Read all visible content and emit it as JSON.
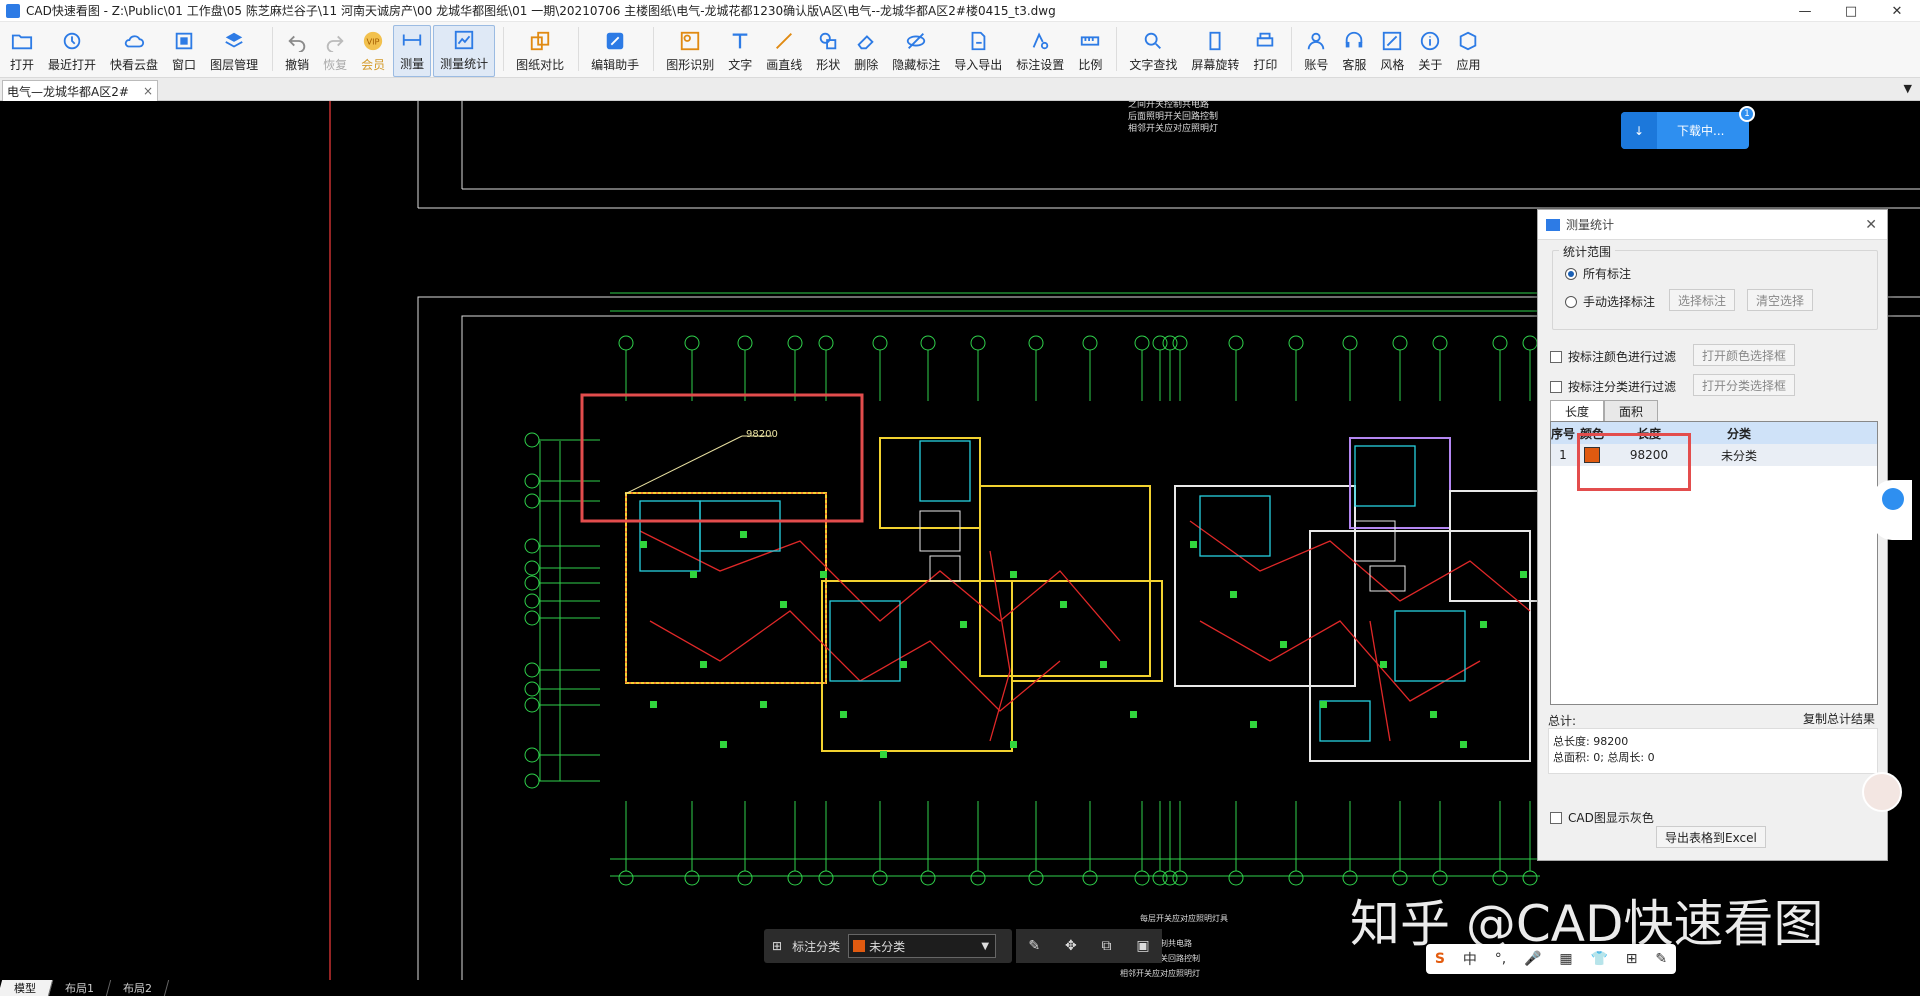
{
  "window": {
    "title": "CAD快速看图 - Z:\\Public\\01 工作盘\\05 陈芝麻烂谷子\\11 河南天诚房产\\00 龙城华都图纸\\01 一期\\20210706 主楼图纸\\电气-龙城花都1230确认版\\A区\\电气--龙城华都A区2#楼0415_t3.dwg",
    "controls": {
      "minimize": "—",
      "maximize": "□",
      "close": "✕"
    }
  },
  "toolbar": {
    "items": [
      {
        "label": "打开",
        "icon": "folder-open-icon"
      },
      {
        "label": "最近打开",
        "icon": "history-icon"
      },
      {
        "label": "快看云盘",
        "icon": "cloud-icon"
      },
      {
        "label": "窗口",
        "icon": "window-icon"
      },
      {
        "label": "图层管理",
        "icon": "layers-icon"
      },
      {
        "label": "撤销",
        "icon": "undo-icon"
      },
      {
        "label": "恢复",
        "icon": "redo-icon"
      },
      {
        "label": "会员",
        "icon": "vip-icon"
      },
      {
        "label": "测量",
        "icon": "measure-icon"
      },
      {
        "label": "测量统计",
        "icon": "measure-stats-icon"
      },
      {
        "label": "图纸对比",
        "icon": "compare-icon"
      },
      {
        "label": "编辑助手",
        "icon": "edit-assistant-icon"
      },
      {
        "label": "图形识别",
        "icon": "shape-recognition-icon"
      },
      {
        "label": "文字",
        "icon": "text-icon"
      },
      {
        "label": "画直线",
        "icon": "line-icon"
      },
      {
        "label": "形状",
        "icon": "shape-icon"
      },
      {
        "label": "删除",
        "icon": "eraser-icon"
      },
      {
        "label": "隐藏标注",
        "icon": "hide-annotation-icon"
      },
      {
        "label": "导入导出",
        "icon": "import-export-icon"
      },
      {
        "label": "标注设置",
        "icon": "annotation-settings-icon"
      },
      {
        "label": "比例",
        "icon": "scale-icon"
      },
      {
        "label": "文字查找",
        "icon": "text-search-icon"
      },
      {
        "label": "屏幕旋转",
        "icon": "rotate-screen-icon"
      },
      {
        "label": "打印",
        "icon": "print-icon"
      },
      {
        "label": "账号",
        "icon": "account-icon"
      },
      {
        "label": "客服",
        "icon": "support-icon"
      },
      {
        "label": "风格",
        "icon": "style-icon"
      },
      {
        "label": "关于",
        "icon": "info-icon"
      },
      {
        "label": "应用",
        "icon": "apps-icon"
      }
    ]
  },
  "tabs": {
    "doc_tab": "电气—龙城华都A区2#",
    "close": "×"
  },
  "layout_tabs": [
    "模型",
    "布局1",
    "布局2"
  ],
  "download": {
    "label": "下载中...",
    "badge": "1"
  },
  "annotation": {
    "value": "98200"
  },
  "dialog": {
    "title": "测量统计",
    "close": "✕",
    "scope_label": "统计范围",
    "radio_all": "所有标注",
    "radio_manual": "手动选择标注",
    "btn_select": "选择标注",
    "btn_clear": "清空选择",
    "filter_color": "按标注颜色进行过滤",
    "btn_color": "打开颜色选择框",
    "filter_category": "按标注分类进行过滤",
    "btn_category": "打开分类选择框",
    "tab_length": "长度",
    "tab_area": "面积",
    "headers": {
      "index": "序号",
      "color": "颜色",
      "length": "长度",
      "category": "分类"
    },
    "rows": [
      {
        "index": "1",
        "color": "#e05a10",
        "length": "98200",
        "category": "未分类"
      }
    ],
    "total_label": "总计:",
    "btn_copy": "复制总计结果",
    "total_length": "总长度: 98200",
    "total_area": "总面积: 0; 总周长: 0",
    "gray_checkbox": "CAD图显示灰色",
    "btn_export": "导出表格到Excel"
  },
  "bottom_bar": {
    "category_label": "标注分类",
    "category_value": "未分类"
  },
  "ime": {
    "items": [
      "S",
      "中",
      "°,",
      "🎤",
      "▦",
      "👕",
      "⊞",
      "✎"
    ]
  },
  "watermark": "知乎 @CAD快速看图",
  "colors": {
    "accent": "#2e8ff0",
    "swatch": "#e05a10",
    "highlight": "#e34d4d"
  }
}
